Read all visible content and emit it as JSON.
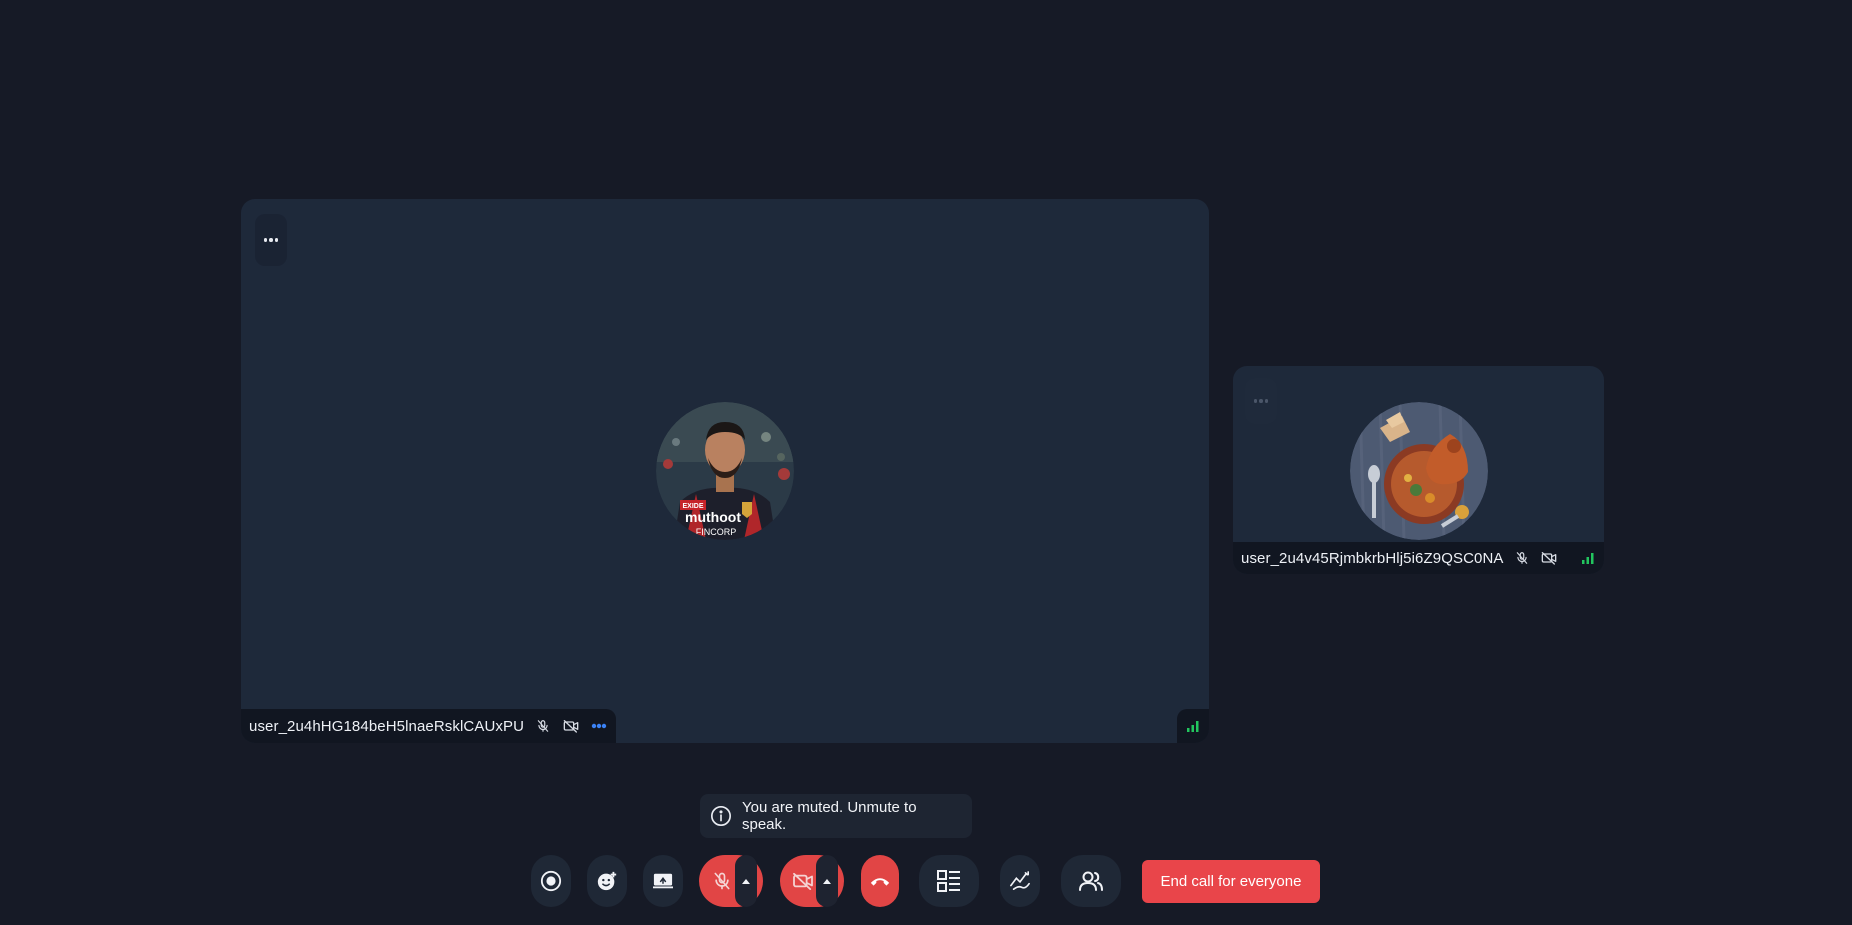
{
  "participants": [
    {
      "name": "user_2u4hHG184beH5lnaeRsklCAUxPU",
      "avatar": "portrait-avatar",
      "mic": "muted",
      "camera": "off",
      "speaking_indicator": "dots-blue"
    },
    {
      "name": "user_2u4v45RjmbkrbHlj5i6Z9QSC0NA",
      "avatar": "food-dish-avatar",
      "mic": "muted",
      "camera": "off"
    }
  ],
  "toast": {
    "icon": "info-icon",
    "message": "You are muted. Unmute to speak."
  },
  "controls": {
    "record_icon": "record-icon",
    "reactions_icon": "emoji-add-icon",
    "screen_share_icon": "screen-share-icon",
    "mic_icon": "mic-off-icon",
    "camera_icon": "camera-off-icon",
    "hangup_icon": "phone-hangup-icon",
    "layout_icon": "layout-icon",
    "whiteboard_icon": "whiteboard-icon",
    "participants_icon": "participants-icon",
    "end_call_label": "End call for everyone"
  },
  "colors": {
    "background": "#161a26",
    "tile": "#1e293a",
    "danger": "#e14545",
    "signal": "#22c55e",
    "active_dots": "#3b82f6"
  }
}
